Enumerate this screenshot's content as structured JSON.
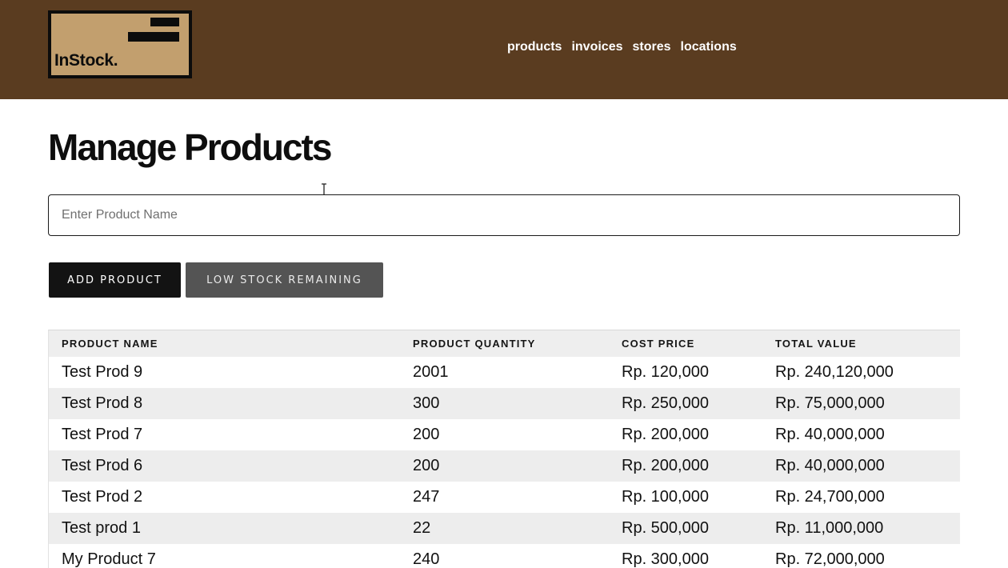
{
  "header": {
    "logo_text": "InStock.",
    "nav": [
      "products",
      "invoices",
      "stores",
      "locations"
    ]
  },
  "main": {
    "title": "Manage Products",
    "search": {
      "placeholder": "Enter Product Name",
      "value": ""
    },
    "buttons": {
      "add": "ADD PRODUCT",
      "low_stock": "LOW STOCK REMAINING"
    }
  },
  "table": {
    "columns": [
      "PRODUCT NAME",
      "PRODUCT QUANTITY",
      "COST PRICE",
      "TOTAL VALUE"
    ],
    "rows": [
      [
        "Test Prod 9",
        "2001",
        "Rp. 120,000",
        "Rp. 240,120,000"
      ],
      [
        "Test Prod 8",
        "300",
        "Rp. 250,000",
        "Rp. 75,000,000"
      ],
      [
        "Test Prod 7",
        "200",
        "Rp. 200,000",
        "Rp. 40,000,000"
      ],
      [
        "Test Prod 6",
        "200",
        "Rp. 200,000",
        "Rp. 40,000,000"
      ],
      [
        "Test Prod 2",
        "247",
        "Rp. 100,000",
        "Rp. 24,700,000"
      ],
      [
        "Test prod 1",
        "22",
        "Rp. 500,000",
        "Rp. 11,000,000"
      ],
      [
        "My Product 7",
        "240",
        "Rp. 300,000",
        "Rp. 72,000,000"
      ]
    ]
  },
  "colors": {
    "header_bg": "#5a3c20",
    "logo_bg": "#c29f6e",
    "primary_button": "#131313",
    "secondary_button": "#545454"
  }
}
